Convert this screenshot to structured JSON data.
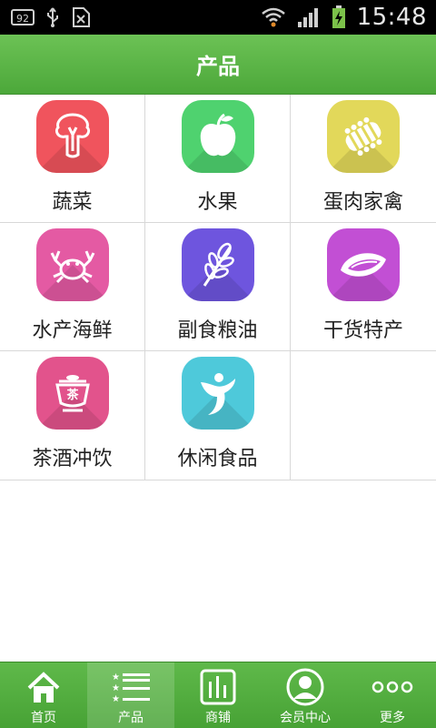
{
  "status_bar": {
    "time": "15:48",
    "left_icons": [
      "notification-badge-icon",
      "usb-icon",
      "sim-icon"
    ],
    "notification_badge": "92",
    "right_icons": [
      "wifi-icon",
      "signal-icon",
      "battery-charging-icon"
    ]
  },
  "header": {
    "title": "产品"
  },
  "categories": [
    {
      "label": "蔬菜",
      "icon": "mushroom-icon",
      "color": "#f0545d"
    },
    {
      "label": "水果",
      "icon": "apple-icon",
      "color": "#4fd26f"
    },
    {
      "label": "蛋肉家禽",
      "icon": "ribs-icon",
      "color": "#e2d85a"
    },
    {
      "label": "水产海鲜",
      "icon": "crab-icon",
      "color": "#e45aa3"
    },
    {
      "label": "副食粮油",
      "icon": "wheat-icon",
      "color": "#6e55de"
    },
    {
      "label": "干货特产",
      "icon": "seed-icon",
      "color": "#c24fd4"
    },
    {
      "label": "茶酒冲饮",
      "icon": "tea-icon",
      "color": "#e2538c",
      "icon_text": "茶"
    },
    {
      "label": "休闲食品",
      "icon": "leisure-icon",
      "color": "#4ec9da"
    }
  ],
  "bottom_nav": [
    {
      "label": "首页",
      "icon": "home-icon"
    },
    {
      "label": "产品",
      "icon": "list-icon",
      "active": true
    },
    {
      "label": "商铺",
      "icon": "shop-icon"
    },
    {
      "label": "会员中心",
      "icon": "member-icon"
    },
    {
      "label": "更多",
      "icon": "more-icon"
    }
  ],
  "colors": {
    "header_green": "#58b245",
    "nav_green": "#52ad3f",
    "status_bar": "#000000"
  }
}
